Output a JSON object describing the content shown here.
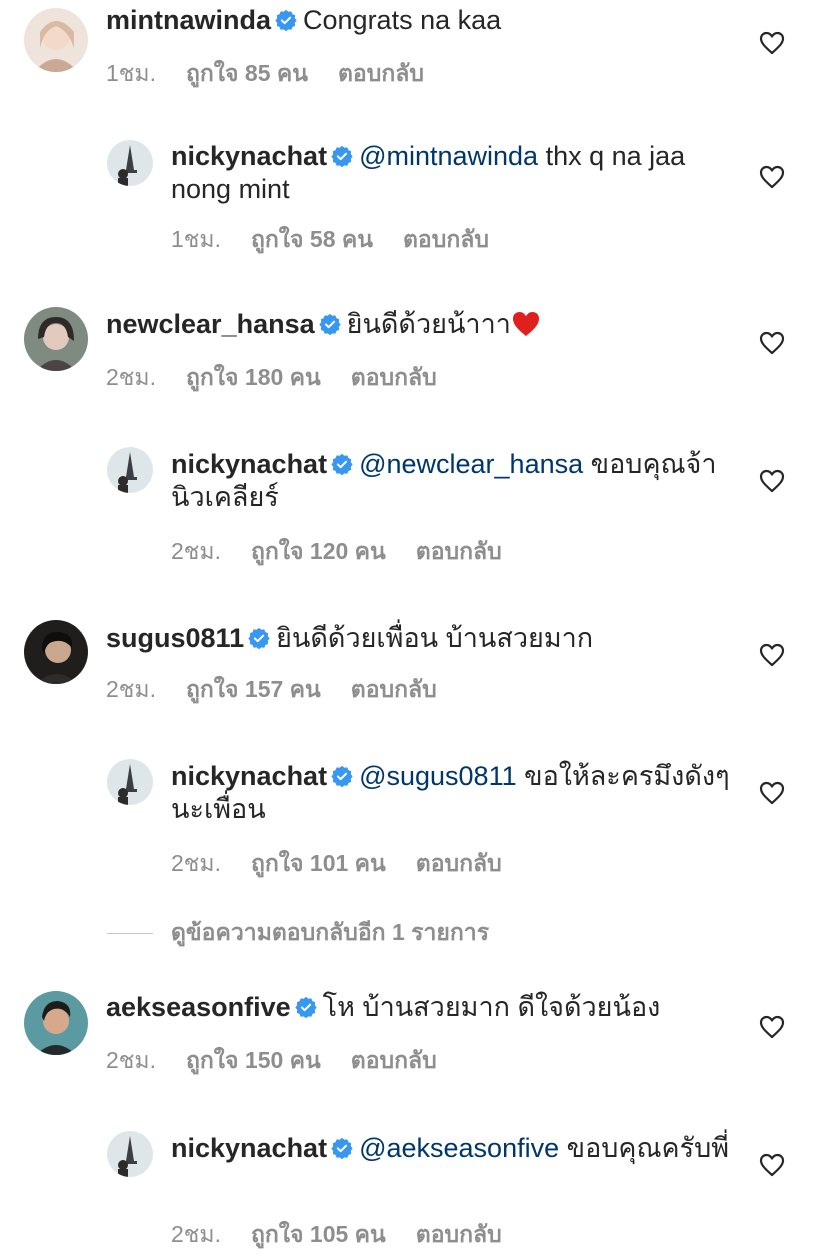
{
  "comments": [
    {
      "username": "mintnawinda",
      "mention": "",
      "text": "Congrats na kaa",
      "time": "1ชม.",
      "likes": "ถูกใจ 85 คน",
      "reply": "ตอบกลับ",
      "avatar_color": "#e9d3c7"
    },
    {
      "username": "nickynachat",
      "mention": "@mintnawinda",
      "text": " thx q na jaa nong mint",
      "time": "1ชม.",
      "likes": "ถูกใจ 58 คน",
      "reply": "ตอบกลับ",
      "avatar_color": "#cfd8dd"
    },
    {
      "username": "newclear_hansa",
      "mention": "",
      "text": "ยินดีด้วยน้าาา",
      "time": "2ชม.",
      "likes": "ถูกใจ 180 คน",
      "reply": "ตอบกลับ",
      "avatar_color": "#9da79a"
    },
    {
      "username": "nickynachat",
      "mention": "@newclear_hansa",
      "text": " ขอบคุณจ้า นิวเคลียร์",
      "time": "2ชม.",
      "likes": "ถูกใจ 120 คน",
      "reply": "ตอบกลับ",
      "avatar_color": "#cfd8dd"
    },
    {
      "username": "sugus0811",
      "mention": "",
      "text": "ยินดีด้วยเพื่อน บ้านสวยมาก",
      "time": "2ชม.",
      "likes": "ถูกใจ 157 คน",
      "reply": "ตอบกลับ",
      "avatar_color": "#3a3836"
    },
    {
      "username": "nickynachat",
      "mention": "@sugus0811",
      "text": "  ขอให้ละครมึงดังๆนะเพื่อน",
      "time": "2ชม.",
      "likes": "ถูกใจ 101 คน",
      "reply": "ตอบกลับ",
      "avatar_color": "#cfd8dd"
    },
    {
      "username": "aekseasonfive",
      "mention": "",
      "text": "โห บ้านสวยมาก ดีใจด้วยน้อง",
      "time": "2ชม.",
      "likes": "ถูกใจ 150 คน",
      "reply": "ตอบกลับ",
      "avatar_color": "#4d8a8f"
    },
    {
      "username": "nickynachat",
      "mention": "@aekseasonfive",
      "text": " ขอบคุณครับพี่",
      "time": "2ชม.",
      "likes": "ถูกใจ 105 คน",
      "reply": "ตอบกลับ",
      "avatar_color": "#cfd8dd"
    }
  ],
  "view_more_replies": "ดูข้อความตอบกลับอีก 1 รายการ",
  "colors": {
    "verified": "#3897f0",
    "mention": "#00376b",
    "meta": "#8e8e8e",
    "text": "#262626"
  },
  "icons": {
    "verified": "verified-badge-icon",
    "heart": "heart-outline-icon",
    "emoji": "red-heart-emoji"
  }
}
